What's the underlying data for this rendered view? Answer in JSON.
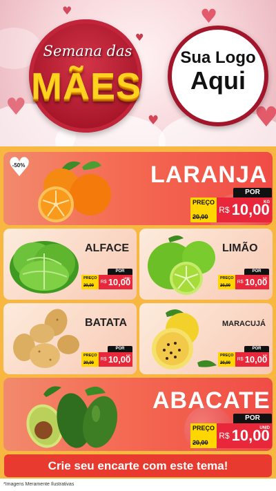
{
  "header": {
    "script_title": "Semana das",
    "big_title": "MÃES",
    "logo_line1": "Sua Logo",
    "logo_line2": "Aqui"
  },
  "offers": {
    "laranja": {
      "name": "LARANJA",
      "badge": "-50%",
      "por": "POR",
      "preco": "PREÇO",
      "old": "20,00",
      "currency": "R$",
      "value": "10,00",
      "unit": "KG"
    },
    "alface": {
      "name": "ALFACE",
      "por": "POR",
      "preco": "PREÇO",
      "old": "20,00",
      "currency": "R$",
      "value": "10,00",
      "unit": "UNID"
    },
    "limao": {
      "name": "LIMÃO",
      "por": "POR",
      "preco": "PREÇO",
      "old": "20,00",
      "currency": "R$",
      "value": "10,00",
      "unit": "KG"
    },
    "batata": {
      "name": "BATATA",
      "por": "POR",
      "preco": "PREÇO",
      "old": "20,00",
      "currency": "R$",
      "value": "10,00",
      "unit": "KG"
    },
    "maracuja": {
      "name": "MARACUJÁ",
      "por": "POR",
      "preco": "PREÇO",
      "old": "20,00",
      "currency": "R$",
      "value": "10,00",
      "unit": "KG"
    },
    "abacate": {
      "name": "ABACATE",
      "por": "POR",
      "preco": "PREÇO",
      "old": "20,00",
      "currency": "R$",
      "value": "10,00",
      "unit": "UNID"
    }
  },
  "footer": {
    "cta": "Crie seu encarte com este tema!",
    "disclaimer": "*Imagens Meramente Ilustrativas"
  },
  "colors": {
    "brand_red": "#a8162a",
    "accent_yellow": "#ffd600",
    "price_red": "#e8283a",
    "background_orange": "#f7b741"
  },
  "icons": [
    "orange-icon",
    "lettuce-icon",
    "lime-icon",
    "potato-icon",
    "passion-fruit-icon",
    "avocado-icon",
    "heart-icon"
  ]
}
